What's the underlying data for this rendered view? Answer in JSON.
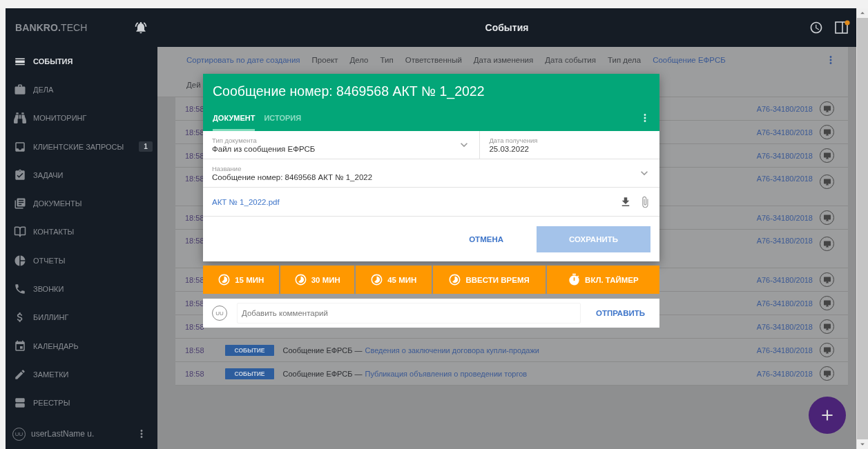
{
  "sidebar": {
    "logo": "**BANKRO.**TECH",
    "items": [
      {
        "label": "СОБЫТИЯ",
        "selected": true
      },
      {
        "label": "ДЕЛА",
        "selected": false
      },
      {
        "label": "МОНИТОРИНГ",
        "selected": false
      },
      {
        "label": "КЛИЕНТСКИЕ ЗАПРОСЫ",
        "selected": false,
        "badge": "1"
      },
      {
        "label": "ЗАДАЧИ",
        "selected": false
      },
      {
        "label": "ДОКУМЕНТЫ",
        "selected": false
      },
      {
        "label": "КОНТАКТЫ",
        "selected": false
      },
      {
        "label": "ОТЧЕТЫ",
        "selected": false
      },
      {
        "label": "ЗВОНКИ",
        "selected": false
      },
      {
        "label": "БИЛЛИНГ",
        "selected": false
      },
      {
        "label": "КАЛЕНДАРЬ",
        "selected": false
      },
      {
        "label": "ЗАМЕТКИ",
        "selected": false
      },
      {
        "label": "РЕЕСТРЫ",
        "selected": false
      }
    ],
    "user": {
      "avatar": "UU",
      "name": "userLastName u."
    }
  },
  "header": {
    "title": "События",
    "notification_dot": true
  },
  "filters": {
    "items": [
      {
        "label": "Сортировать по дате создания",
        "active": true
      },
      {
        "label": "Проект",
        "active": false
      },
      {
        "label": "Дело",
        "active": false
      },
      {
        "label": "Тип",
        "active": false
      },
      {
        "label": "Ответственный",
        "active": false
      },
      {
        "label": "Дата изменения",
        "active": false
      },
      {
        "label": "Дата события",
        "active": false
      },
      {
        "label": "Тип дела",
        "active": false
      },
      {
        "label": "Сообщение ЕФРСБ",
        "active": true
      }
    ],
    "second_line": "Дей"
  },
  "rows": [
    {
      "time": "18:58",
      "case": "А76-34180/2018",
      "tall": false
    },
    {
      "time": "18:58",
      "case": "А76-34180/2018",
      "tall": false
    },
    {
      "time": "18:58",
      "case": "А76-34180/2018",
      "tall": false
    },
    {
      "time": "18:58",
      "case": "А76-34180/2018",
      "tall": true
    },
    {
      "time": "18:58",
      "case": "А76-34180/2018",
      "tall": false
    },
    {
      "time": "18:58",
      "case": "А76-34180/2018",
      "tall": true
    },
    {
      "time": "18:58",
      "case": "А76-34180/2018",
      "tall": false
    },
    {
      "time": "18:58",
      "case": "А76-34180/2018",
      "tall": false
    },
    {
      "time": "18:58",
      "case": "А76-34180/2018",
      "tall": false
    },
    {
      "time": "18:58",
      "case": "А76-34180/2018",
      "tall": false,
      "badge": "СОБЫТИЕ",
      "source": "Сообщение ЕФРСБ —",
      "link": "Сведения о заключении договора купли-продажи"
    },
    {
      "time": "18:58",
      "case": "А76-34180/2018",
      "tall": false,
      "badge": "СОБЫТИЕ",
      "source": "Сообщение ЕФРСБ —",
      "link": "Публикация объявления о проведении торгов"
    }
  ],
  "dialog": {
    "title": "Сообщение номер: 8469568 АКТ № 1_2022",
    "tabs": [
      {
        "label": "ДОКУМЕНТ",
        "selected": true
      },
      {
        "label": "ИСТОРИЯ",
        "selected": false
      }
    ],
    "doc_type": {
      "label": "Тип документа",
      "value": "Файл из сообщения ЕФРСБ"
    },
    "received": {
      "label": "Дата получения",
      "value": "25.03.2022"
    },
    "name": {
      "label": "Название",
      "value": "Сообщение номер: 8469568 АКТ № 1_2022"
    },
    "file": "АКТ № 1_2022.pdf",
    "cancel": "ОТМЕНА",
    "save": {
      "label": "СОХРАНИТЬ",
      "disabled": true
    }
  },
  "time_buttons": [
    {
      "label": "15 МИН",
      "kind": "time"
    },
    {
      "label": "30 МИН",
      "kind": "time"
    },
    {
      "label": "45 МИН",
      "kind": "time"
    },
    {
      "label": "ВВЕСТИ ВРЕМЯ",
      "kind": "time"
    },
    {
      "label": "ВКЛ. ТАЙМЕР",
      "kind": "timer"
    }
  ],
  "comment": {
    "avatar": "UU",
    "placeholder": "Добавить комментарий",
    "send": "ОТПРАВИТЬ"
  }
}
